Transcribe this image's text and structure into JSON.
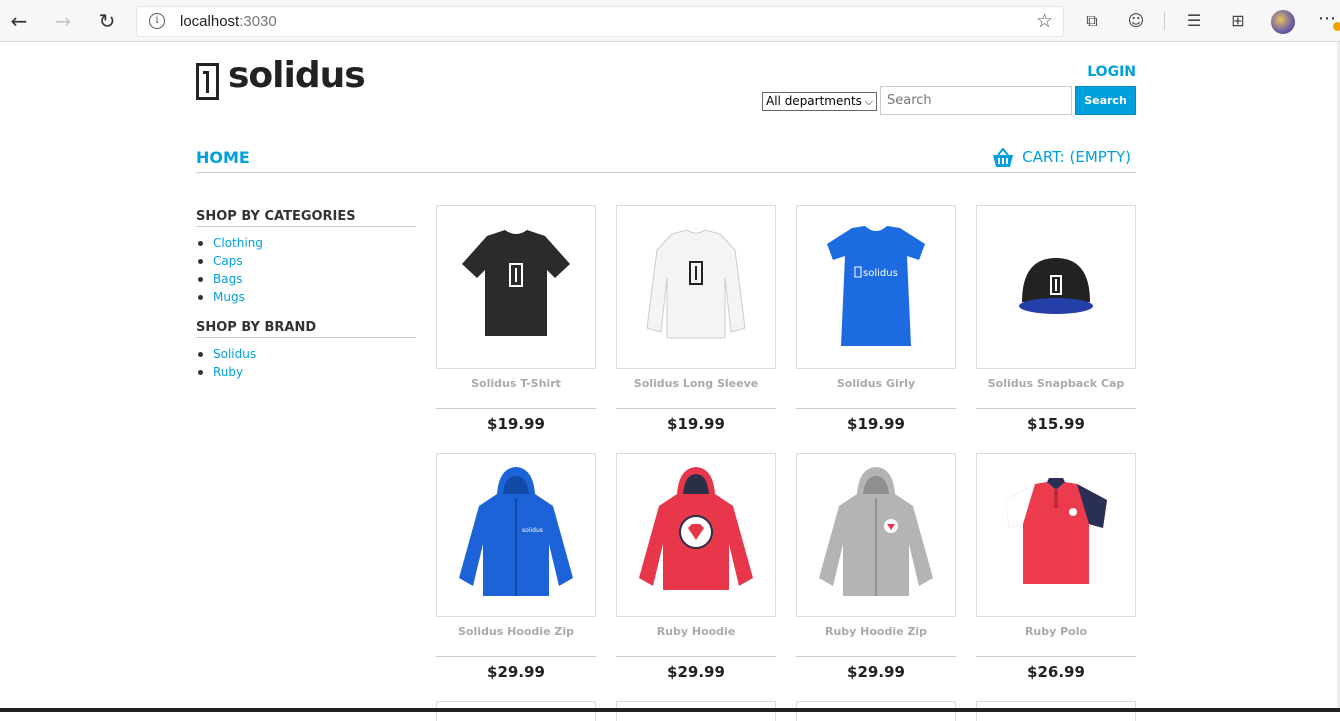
{
  "browser": {
    "url_host": "localhost",
    "url_port": ":3030"
  },
  "header": {
    "logo_text": "solidus",
    "login_label": "LOGIN",
    "department_selected": "All departments",
    "search_placeholder": "Search",
    "search_button": "Search"
  },
  "nav": {
    "home_label": "HOME",
    "cart_label": "CART: (EMPTY)"
  },
  "sidebar": {
    "categories_title": "SHOP BY CATEGORIES",
    "categories": [
      {
        "label": "Clothing"
      },
      {
        "label": "Caps"
      },
      {
        "label": "Bags"
      },
      {
        "label": "Mugs"
      }
    ],
    "brand_title": "SHOP BY BRAND",
    "brands": [
      {
        "label": "Solidus"
      },
      {
        "label": "Ruby"
      }
    ]
  },
  "products": [
    {
      "name": "Solidus T-Shirt",
      "price": "$19.99",
      "image": "black-tshirt"
    },
    {
      "name": "Solidus Long Sleeve",
      "price": "$19.99",
      "image": "white-longsleeve"
    },
    {
      "name": "Solidus Girly",
      "price": "$19.99",
      "image": "blue-girly-tee"
    },
    {
      "name": "Solidus Snapback Cap",
      "price": "$15.99",
      "image": "black-cap"
    },
    {
      "name": "Solidus Hoodie Zip",
      "price": "$29.99",
      "image": "blue-hoodie"
    },
    {
      "name": "Ruby Hoodie",
      "price": "$29.99",
      "image": "red-hoodie"
    },
    {
      "name": "Ruby Hoodie Zip",
      "price": "$29.99",
      "image": "grey-hoodie"
    },
    {
      "name": "Ruby Polo",
      "price": "$26.99",
      "image": "red-polo"
    }
  ],
  "colors": {
    "accent": "#00a0de",
    "text": "#222222",
    "muted": "#aaaaaa"
  }
}
